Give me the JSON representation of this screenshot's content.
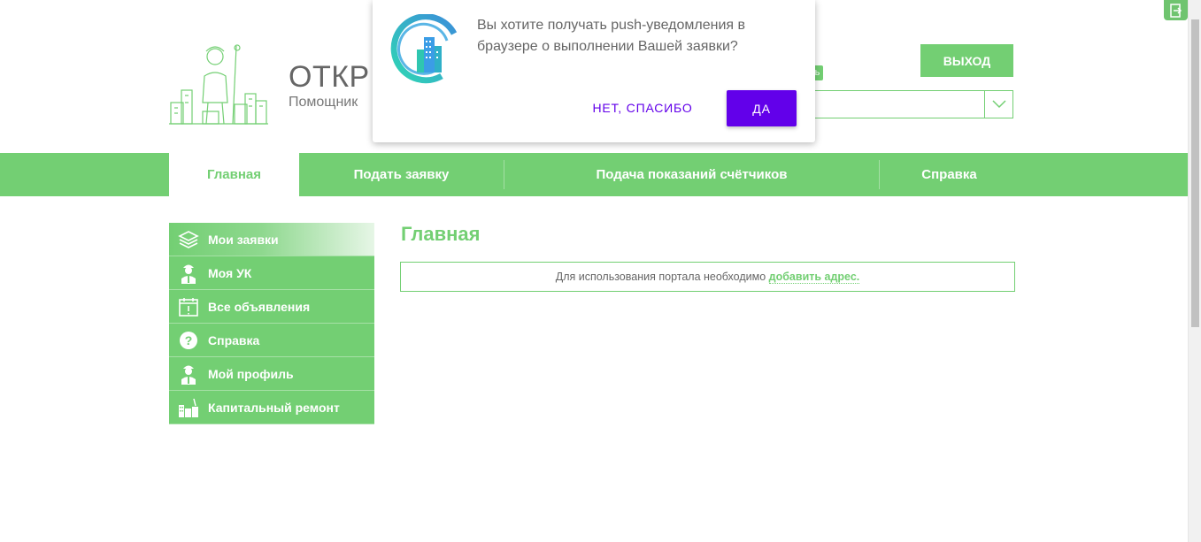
{
  "header": {
    "brand_title": "ОТКР",
    "brand_subtitle": "Помощник",
    "profile_tag": "иль",
    "logout_label": "ВЫХОД",
    "address_select_value": ""
  },
  "nav": {
    "items": [
      {
        "label": "Главная",
        "active": true
      },
      {
        "label": "Подать заявку",
        "active": false
      },
      {
        "label": "Подача показаний счётчиков",
        "active": false
      },
      {
        "label": "Справка",
        "active": false
      }
    ]
  },
  "sidebar": {
    "items": [
      {
        "label": "Мои заявки",
        "icon": "layers-icon",
        "active": true
      },
      {
        "label": "Моя УК",
        "icon": "worker-icon",
        "active": false
      },
      {
        "label": "Все объявления",
        "icon": "calendar-alert-icon",
        "active": false
      },
      {
        "label": "Справка",
        "icon": "question-icon",
        "active": false
      },
      {
        "label": "Мой профиль",
        "icon": "worker-icon",
        "active": false
      },
      {
        "label": "Капитальный ремонт",
        "icon": "building-repair-icon",
        "active": false
      }
    ]
  },
  "main": {
    "title": "Главная",
    "notice_text": "Для использования портала необходимо ",
    "notice_link": "добавить адрес."
  },
  "popup": {
    "message": "Вы хотите получать push-уведомления в браузере о выполнении Вашей заявки?",
    "no_label": "Нет, спасибо",
    "yes_label": "Да"
  },
  "colors": {
    "brand_green": "#73cf73",
    "popup_accent": "#6200ea"
  }
}
